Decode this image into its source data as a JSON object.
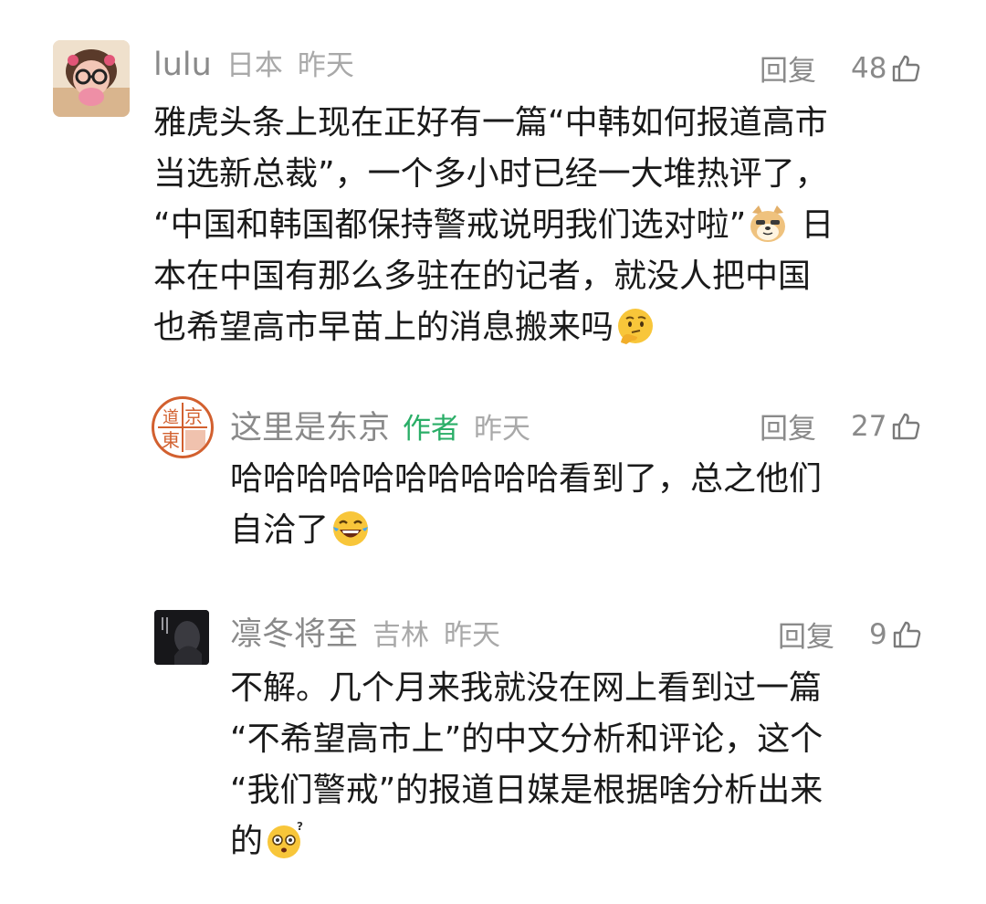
{
  "comments": [
    {
      "user": "lulu",
      "location": "日本",
      "time": "昨天",
      "reply_label": "回复",
      "likes": "48",
      "lines": [
        "雅虎头条上现在正好有一篇“中韩如何报道高市",
        "当选新总裁”，一个多小时已经一大堆热评了，",
        "“中国和韩国都保持警戒说明我们选对啦”",
        "日",
        "本在中国有那么多驻在的记者，就没人把中国",
        "也希望高市早苗上的消息搬来吗"
      ],
      "emojis": [
        "doge-emoji",
        "thinking-emoji"
      ]
    },
    {
      "user": "这里是东京",
      "badge": "作者",
      "time": "昨天",
      "reply_label": "回复",
      "likes": "27",
      "lines": [
        "哈哈哈哈哈哈哈哈哈哈看到了，总之他们",
        "自洽了"
      ],
      "emojis": [
        "laughing-tears-emoji"
      ],
      "avatar_seal_text": [
        "京",
        "東",
        "道"
      ]
    },
    {
      "user": "凛冬将至",
      "location": "吉林",
      "time": "昨天",
      "reply_label": "回复",
      "likes": "9",
      "lines": [
        "不解。几个月来我就没在网上看到过一篇",
        "“不希望高市上”的中文分析和评论，这个",
        "“我们警戒”的报道日媒是根据啥分析出来",
        "的"
      ],
      "emojis": [
        "confused-emoji"
      ]
    }
  ],
  "colors": {
    "username": "#8a8a8a",
    "meta": "#a9a9a9",
    "author_badge": "#2aae67",
    "text": "#1a1a1a",
    "seal_red": "#d2602f"
  }
}
